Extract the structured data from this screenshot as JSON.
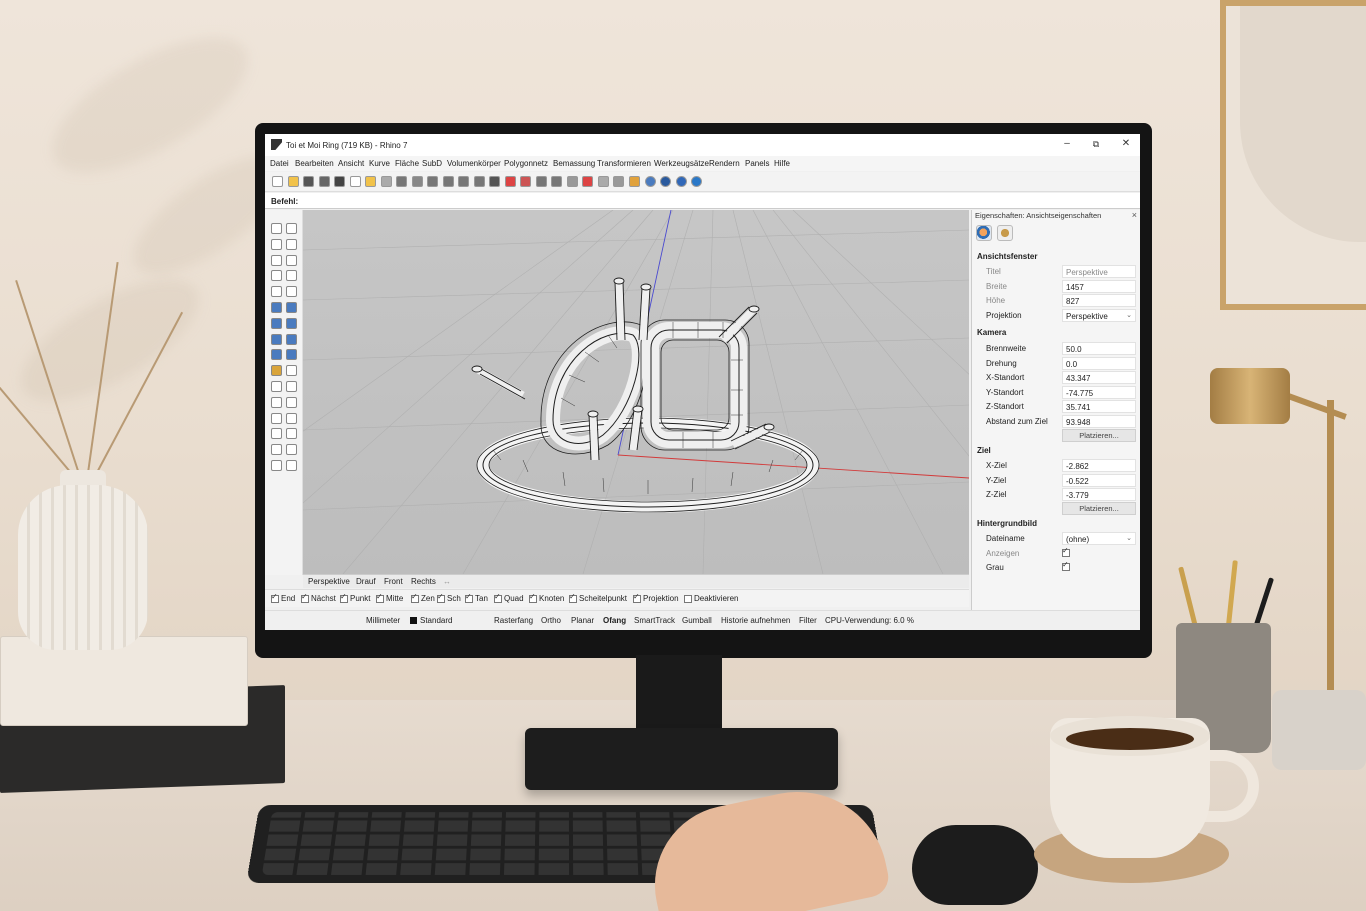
{
  "window": {
    "title": "Toi et Moi Ring (719 KB) - Rhino 7",
    "minimize": "–",
    "maximize": "⧉",
    "close": "✕"
  },
  "menu": [
    "Datei",
    "Bearbeiten",
    "Ansicht",
    "Kurve",
    "Fläche",
    "SubD",
    "Volumenkörper",
    "Polygonnetz",
    "Bemassung",
    "Transformieren",
    "Werkzeugsätze",
    "Rendern",
    "Panels",
    "Hilfe"
  ],
  "command": {
    "label": "Befehl:",
    "value": ""
  },
  "viewport_tabs": [
    "Perspektive",
    "Drauf",
    "Front",
    "Rechts",
    "↔"
  ],
  "osnaps": [
    {
      "label": "End",
      "checked": true
    },
    {
      "label": "Nächst",
      "checked": true
    },
    {
      "label": "Punkt",
      "checked": true
    },
    {
      "label": "Mitte",
      "checked": true
    },
    {
      "label": "Zen",
      "checked": true
    },
    {
      "label": "Sch",
      "checked": true
    },
    {
      "label": "Tan",
      "checked": true
    },
    {
      "label": "Quad",
      "checked": true
    },
    {
      "label": "Knoten",
      "checked": true
    },
    {
      "label": "Scheitelpunkt",
      "checked": true
    },
    {
      "label": "Projektion",
      "checked": true
    },
    {
      "label": "Deaktivieren",
      "checked": false
    }
  ],
  "status": {
    "units": "Millimeter",
    "layer": "Standard",
    "rasterfang": "Rasterfang",
    "ortho": "Ortho",
    "planar": "Planar",
    "ofang": "Ofang",
    "smarttrack": "SmartTrack",
    "gumball": "Gumball",
    "historie": "Historie aufnehmen",
    "filter": "Filter",
    "cpu": "CPU-Verwendung: 6.0 %"
  },
  "panel": {
    "title": "Eigenschaften: Ansichtseigenschaften",
    "close": "×",
    "ansichtsfenster": {
      "heading": "Ansichtsfenster",
      "titel_label": "Titel",
      "titel_value": "Perspektive",
      "breite_label": "Breite",
      "breite_value": "1457",
      "hoehe_label": "Höhe",
      "hoehe_value": "827",
      "projektion_label": "Projektion",
      "projektion_value": "Perspektive"
    },
    "kamera": {
      "heading": "Kamera",
      "brennweite_label": "Brennweite",
      "brennweite_value": "50.0",
      "drehung_label": "Drehung",
      "drehung_value": "0.0",
      "x_label": "X-Standort",
      "x_value": "43.347",
      "y_label": "Y-Standort",
      "y_value": "-74.775",
      "z_label": "Z-Standort",
      "z_value": "35.741",
      "abstand_label": "Abstand zum Ziel",
      "abstand_value": "93.948",
      "button": "Platzieren..."
    },
    "ziel": {
      "heading": "Ziel",
      "x_label": "X-Ziel",
      "x_value": "-2.862",
      "y_label": "Y-Ziel",
      "y_value": "-0.522",
      "z_label": "Z-Ziel",
      "z_value": "-3.779",
      "button": "Platzieren..."
    },
    "hintergrund": {
      "heading": "Hintergrundbild",
      "datei_label": "Dateiname",
      "datei_value": "(ohne)",
      "anzeigen_label": "Anzeigen",
      "grau_label": "Grau"
    }
  },
  "colors": {
    "accent_blue": "#2f6db5",
    "axis_red": "#d23a3a",
    "axis_blue": "#4a4ad0",
    "viewport_bg": "#c2c2c2"
  }
}
